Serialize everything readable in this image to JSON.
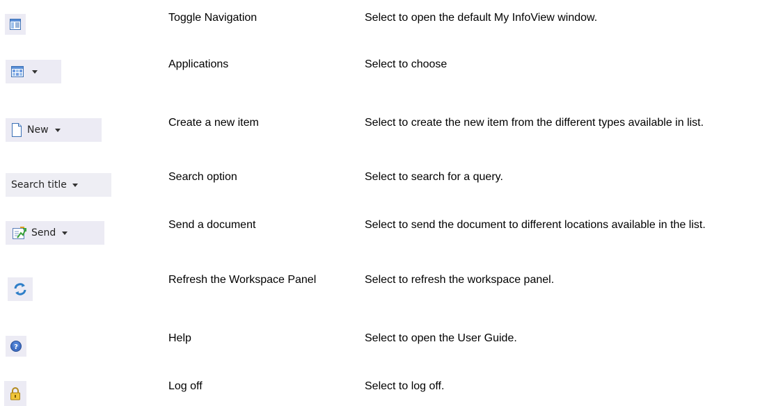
{
  "rows": [
    {
      "icon": "toggle-navigation-icon",
      "button_label": "",
      "name": "Toggle Navigation",
      "description": "Select to open the default My InfoView window."
    },
    {
      "icon": "applications-icon",
      "button_label": "",
      "name": "Applications",
      "description": "Select to choose"
    },
    {
      "icon": "new-document-icon",
      "button_label": "New",
      "name": "Create a new item",
      "description": "Select to create the new item from the different types available in list."
    },
    {
      "icon": "",
      "button_label": "Search title",
      "name": "Search option",
      "description": "Select to search for a  query."
    },
    {
      "icon": "send-document-icon",
      "button_label": "Send",
      "name": "Send a document",
      "description": "Select to send the document to different locations available in the list."
    },
    {
      "icon": "refresh-icon",
      "button_label": "",
      "name": "Refresh the Workspace Panel",
      "description": "Select to refresh the workspace panel."
    },
    {
      "icon": "help-icon",
      "button_label": "",
      "name": "Help",
      "description": "Select to open the User Guide."
    },
    {
      "icon": "lock-icon",
      "button_label": "",
      "name": "Log off",
      "description": "Select to log off."
    }
  ]
}
